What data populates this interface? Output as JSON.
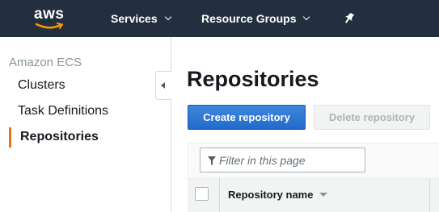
{
  "topnav": {
    "logo_text": "aws",
    "services_label": "Services",
    "resource_groups_label": "Resource Groups",
    "pin_icon": "pin-icon",
    "brand_color": "#232f3e",
    "smile_color": "#ff9900"
  },
  "sidebar": {
    "title": "Amazon ECS",
    "items": [
      {
        "label": "Clusters"
      },
      {
        "label": "Task Definitions"
      },
      {
        "label": "Repositories",
        "active": true
      }
    ],
    "active_color": "#ec7211"
  },
  "main": {
    "title": "Repositories",
    "create_button": "Create repository",
    "delete_button": "Delete repository",
    "filter_placeholder": "Filter in this page",
    "table": {
      "columns": [
        "Repository name"
      ]
    },
    "primary_color": "#2c73d2"
  }
}
